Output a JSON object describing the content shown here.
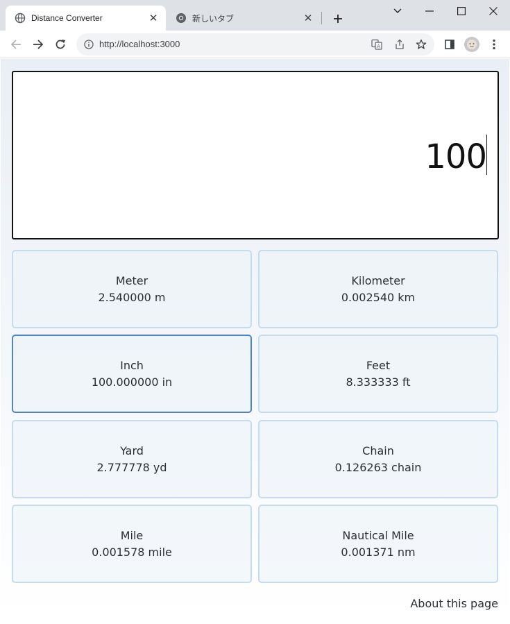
{
  "browser": {
    "tabs": [
      {
        "title": "Distance Converter",
        "active": true
      },
      {
        "title": "新しいタブ",
        "active": false
      }
    ],
    "url": "http://localhost:3000"
  },
  "converter": {
    "input_value": "100",
    "units": [
      {
        "name": "Meter",
        "value": "2.540000 m"
      },
      {
        "name": "Kilometer",
        "value": "0.002540 km"
      },
      {
        "name": "Inch",
        "value": "100.000000 in",
        "selected": true
      },
      {
        "name": "Feet",
        "value": "8.333333 ft"
      },
      {
        "name": "Yard",
        "value": "2.777778 yd"
      },
      {
        "name": "Chain",
        "value": "0.126263 chain"
      },
      {
        "name": "Mile",
        "value": "0.001578 mile"
      },
      {
        "name": "Nautical Mile",
        "value": "0.001371 nm"
      }
    ],
    "about_link": "About this page"
  },
  "colors": {
    "card_border": "#c3dcf3",
    "card_selected_border": "#4a86cf",
    "tabstrip_bg": "#dee1e6"
  }
}
